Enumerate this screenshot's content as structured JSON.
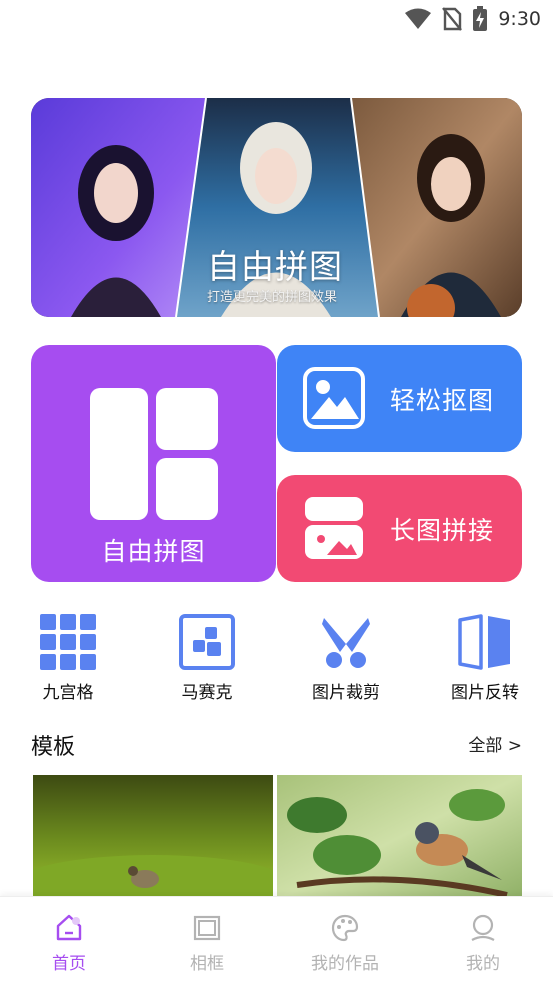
{
  "status_bar": {
    "time": "9:30"
  },
  "banner": {
    "title": "自由拼图",
    "subtitle": "打造更完美的拼图效果"
  },
  "features": {
    "free_collage": {
      "label": "自由拼图"
    },
    "cutout": {
      "label": "轻松抠图"
    },
    "long_image": {
      "label": "长图拼接"
    }
  },
  "tools": [
    {
      "label": "九宫格",
      "icon": "grid-icon"
    },
    {
      "label": "马赛克",
      "icon": "mosaic-icon"
    },
    {
      "label": "图片裁剪",
      "icon": "scissors-icon"
    },
    {
      "label": "图片反转",
      "icon": "flip-icon"
    }
  ],
  "templates": {
    "title": "模板",
    "see_all": "全部 >"
  },
  "nav": [
    {
      "label": "首页",
      "icon": "home-icon",
      "active": true
    },
    {
      "label": "相框",
      "icon": "frame-icon",
      "active": false
    },
    {
      "label": "我的作品",
      "icon": "palette-icon",
      "active": false
    },
    {
      "label": "我的",
      "icon": "user-icon",
      "active": false
    }
  ],
  "colors": {
    "accent": "#a64df0",
    "cutout_card": "#3f84f6",
    "long_image_card": "#f24a73",
    "tool_icon": "#5a82f0"
  }
}
